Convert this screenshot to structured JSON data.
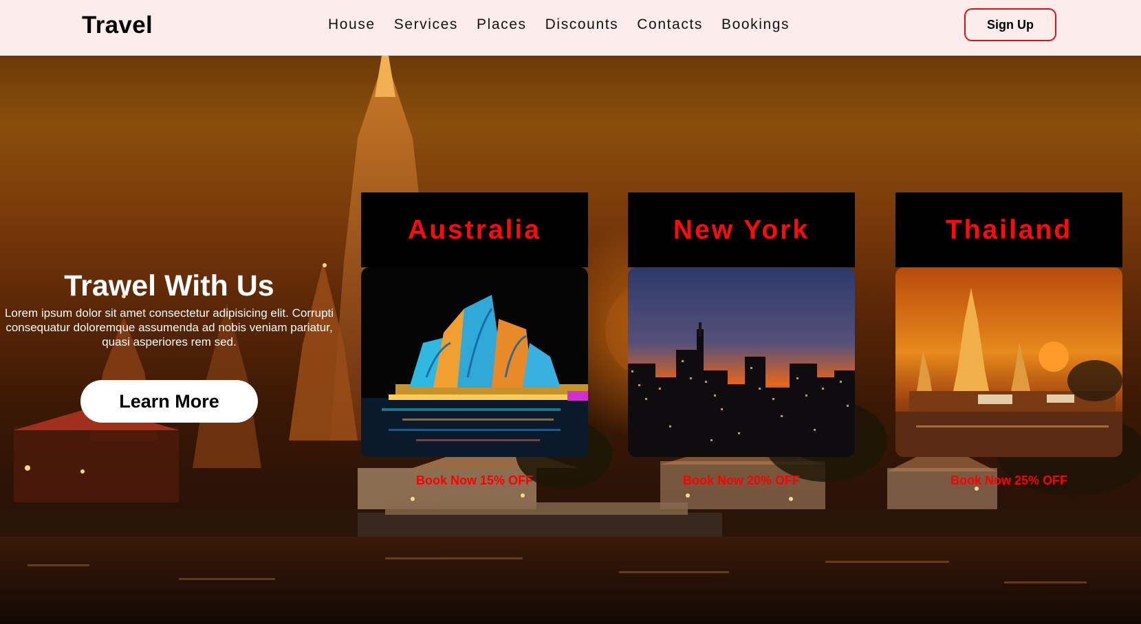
{
  "navbar": {
    "logo": "Travel",
    "links": [
      "House",
      "Services",
      "Places",
      "Discounts",
      "Contacts",
      "Bookings"
    ],
    "signup_label": "Sign Up"
  },
  "hero": {
    "title": "Trawel With Us",
    "text": "Lorem ipsum dolor sit amet consectetur adipisicing elit. Corrupti consequatur doloremque assumenda ad nobis veniam pariatur, quasi asperiores rem sed.",
    "button_label": "Learn More"
  },
  "cards": [
    {
      "title": "Australia",
      "offer": "Book Now 15% OFF"
    },
    {
      "title": "New York",
      "offer": "Book Now 20% OFF"
    },
    {
      "title": "Thailand",
      "offer": "Book Now 25% OFF"
    }
  ],
  "colors": {
    "nav_bg": "#fdecec",
    "accent_red": "#ff0a0a",
    "card_header_bg": "#000000"
  }
}
